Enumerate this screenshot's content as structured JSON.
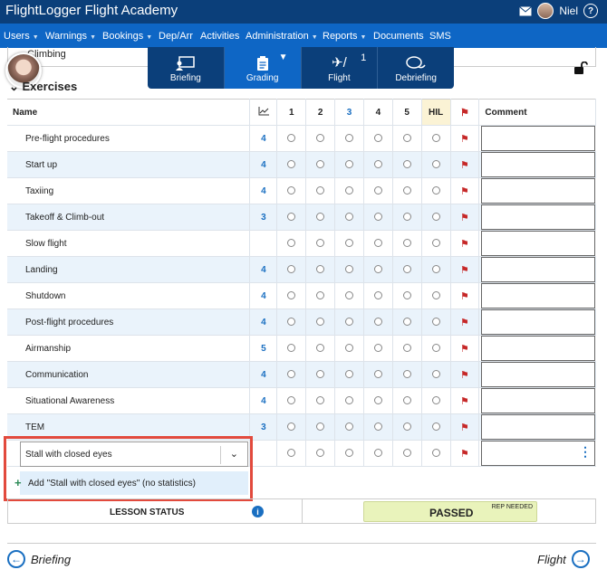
{
  "app": {
    "title": "FlightLogger Flight Academy",
    "user": "Niel"
  },
  "nav": [
    {
      "label": "Users",
      "caret": true
    },
    {
      "label": "Warnings",
      "caret": true
    },
    {
      "label": "Bookings",
      "caret": true
    },
    {
      "label": "Dep/Arr",
      "caret": false
    },
    {
      "label": "Activities",
      "caret": false
    },
    {
      "label": "Administration",
      "caret": true
    },
    {
      "label": "Reports",
      "caret": true
    },
    {
      "label": "Documents",
      "caret": false
    },
    {
      "label": "SMS",
      "caret": false
    }
  ],
  "previous_section": "Climbing",
  "section_title": "Exercises",
  "tabs": [
    {
      "label": "Briefing",
      "icon": "briefing-icon"
    },
    {
      "label": "Grading",
      "icon": "clipboard-icon",
      "active": true
    },
    {
      "label": "Flight",
      "icon": "flight-icon",
      "badge": "1"
    },
    {
      "label": "Debriefing",
      "icon": "chat-icon"
    }
  ],
  "table": {
    "headers": {
      "name": "Name",
      "grades": [
        "1",
        "2",
        "3",
        "4",
        "5"
      ],
      "hil": "HIL",
      "comment": "Comment"
    },
    "rows": [
      {
        "name": "Pre-flight procedures",
        "stat": "4"
      },
      {
        "name": "Start up",
        "stat": "4"
      },
      {
        "name": "Taxiing",
        "stat": "4"
      },
      {
        "name": "Takeoff & Climb-out",
        "stat": "3"
      },
      {
        "name": "Slow flight",
        "stat": ""
      },
      {
        "name": "Landing",
        "stat": "4"
      },
      {
        "name": "Shutdown",
        "stat": "4"
      },
      {
        "name": "Post-flight procedures",
        "stat": "4"
      },
      {
        "name": "Airmanship",
        "stat": "5"
      },
      {
        "name": "Communication",
        "stat": "4"
      },
      {
        "name": "Situational Awareness",
        "stat": "4"
      },
      {
        "name": "TEM",
        "stat": "3"
      }
    ]
  },
  "new_exercise": {
    "value": "Stall with closed eyes",
    "suggestion": "Add \"Stall with closed eyes\" (no statistics)"
  },
  "lesson_status": {
    "label": "LESSON STATUS",
    "value": "PASSED",
    "note": "REP NEEDED"
  },
  "footer": {
    "prev": "Briefing",
    "next": "Flight"
  },
  "colors": {
    "topbar": "#0b3f7a",
    "navbar": "#0e66c5",
    "highlight": "#e24a3d",
    "passed": "#e9f3bb"
  }
}
